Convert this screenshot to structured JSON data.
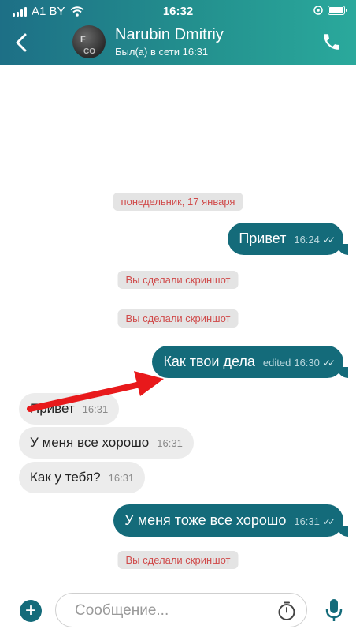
{
  "status_bar": {
    "carrier": "A1 BY",
    "time": "16:32"
  },
  "header": {
    "contact_name": "Narubin Dmitriy",
    "last_seen": "Был(а) в сети 16:31",
    "avatar_text_top": "F",
    "avatar_text_bottom": "CO"
  },
  "chat": {
    "date_separator": "понедельник, 17 января",
    "screenshot_notice": "Вы сделали скриншот",
    "messages": [
      {
        "direction": "out",
        "text": "Привет",
        "time": "16:24",
        "edited": ""
      },
      {
        "direction": "out",
        "text": "Как твои дела",
        "time": "16:30",
        "edited": "edited"
      },
      {
        "direction": "in",
        "text": "Привет",
        "time": "16:31"
      },
      {
        "direction": "in",
        "text": "У меня все хорошо",
        "time": "16:31"
      },
      {
        "direction": "in",
        "text": "Как у тебя?",
        "time": "16:31"
      },
      {
        "direction": "out",
        "text": "У меня тоже все хорошо",
        "time": "16:31",
        "edited": ""
      }
    ]
  },
  "composer": {
    "placeholder": "Сообщение...",
    "icons": [
      "plus-icon",
      "timer-icon",
      "microphone-icon"
    ]
  },
  "colors": {
    "header_gradient_start": "#1d6f86",
    "header_gradient_end": "#2aa99c",
    "outgoing_bubble": "#146b7a",
    "incoming_bubble": "#ececec",
    "notice_text": "#d04a4a",
    "annotation_arrow": "#e8191b"
  }
}
